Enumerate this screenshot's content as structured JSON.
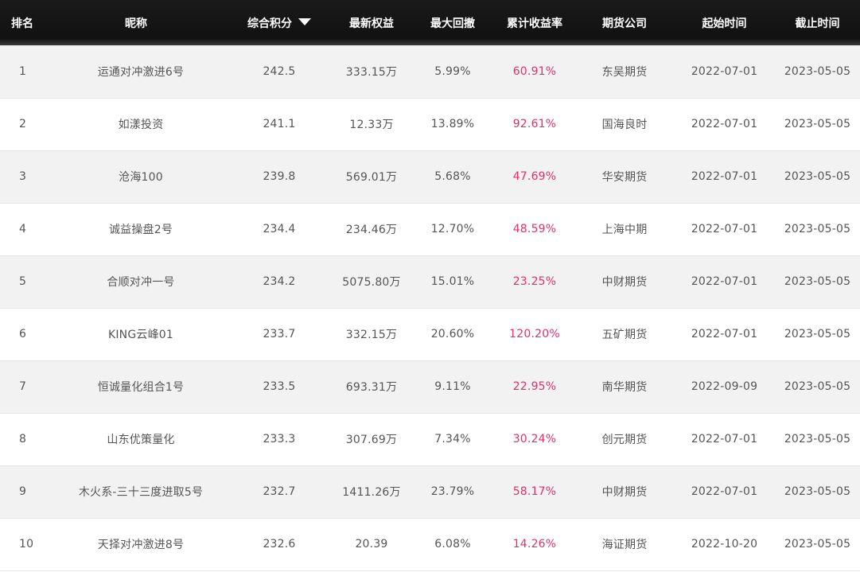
{
  "table": {
    "headers": {
      "rank": "排名",
      "nickname": "昵称",
      "score": "综合积分",
      "latest_equity": "最新权益",
      "max_drawdown": "最大回撤",
      "cumulative_return": "累计收益率",
      "futures_company": "期货公司",
      "start_date": "起始时间",
      "end_date": "截止时间"
    },
    "sort": {
      "column": "score",
      "direction": "descending",
      "icon": "sort-down-icon"
    },
    "colors": {
      "header_bg": "#111111",
      "header_text": "#ffffff",
      "row_odd_bg": "#f2f2f2",
      "row_even_bg": "#ffffff",
      "cell_text": "#555555",
      "return_text": "#e0306b"
    },
    "rows": [
      {
        "rank": "1",
        "nickname": "运通对冲激进6号",
        "score": "242.5",
        "latest_equity": "333.15万",
        "max_drawdown": "5.99%",
        "cumulative_return": "60.91%",
        "futures_company": "东吴期货",
        "start_date": "2022-07-01",
        "end_date": "2023-05-05"
      },
      {
        "rank": "2",
        "nickname": "如漾投资",
        "score": "241.1",
        "latest_equity": "12.33万",
        "max_drawdown": "13.89%",
        "cumulative_return": "92.61%",
        "futures_company": "国海良时",
        "start_date": "2022-07-01",
        "end_date": "2023-05-05"
      },
      {
        "rank": "3",
        "nickname": "沧海100",
        "score": "239.8",
        "latest_equity": "569.01万",
        "max_drawdown": "5.68%",
        "cumulative_return": "47.69%",
        "futures_company": "华安期货",
        "start_date": "2022-07-01",
        "end_date": "2023-05-05"
      },
      {
        "rank": "4",
        "nickname": "诚益操盘2号",
        "score": "234.4",
        "latest_equity": "234.46万",
        "max_drawdown": "12.70%",
        "cumulative_return": "48.59%",
        "futures_company": "上海中期",
        "start_date": "2022-07-01",
        "end_date": "2023-05-05"
      },
      {
        "rank": "5",
        "nickname": "合顺对冲一号",
        "score": "234.2",
        "latest_equity": "5075.80万",
        "max_drawdown": "15.01%",
        "cumulative_return": "23.25%",
        "futures_company": "中财期货",
        "start_date": "2022-07-01",
        "end_date": "2023-05-05"
      },
      {
        "rank": "6",
        "nickname": "KING云峰01",
        "score": "233.7",
        "latest_equity": "332.15万",
        "max_drawdown": "20.60%",
        "cumulative_return": "120.20%",
        "futures_company": "五矿期货",
        "start_date": "2022-07-01",
        "end_date": "2023-05-05"
      },
      {
        "rank": "7",
        "nickname": "恒诚量化组合1号",
        "score": "233.5",
        "latest_equity": "693.31万",
        "max_drawdown": "9.11%",
        "cumulative_return": "22.95%",
        "futures_company": "南华期货",
        "start_date": "2022-09-09",
        "end_date": "2023-05-05"
      },
      {
        "rank": "8",
        "nickname": "山东优策量化",
        "score": "233.3",
        "latest_equity": "307.69万",
        "max_drawdown": "7.34%",
        "cumulative_return": "30.24%",
        "futures_company": "创元期货",
        "start_date": "2022-07-01",
        "end_date": "2023-05-05"
      },
      {
        "rank": "9",
        "nickname": "木火系-三十三度进取5号",
        "score": "232.7",
        "latest_equity": "1411.26万",
        "max_drawdown": "23.79%",
        "cumulative_return": "58.17%",
        "futures_company": "中财期货",
        "start_date": "2022-07-01",
        "end_date": "2023-05-05"
      },
      {
        "rank": "10",
        "nickname": "天择对冲激进8号",
        "score": "232.6",
        "latest_equity": "20.39",
        "max_drawdown": "6.08%",
        "cumulative_return": "14.26%",
        "futures_company": "海证期货",
        "start_date": "2022-10-20",
        "end_date": "2023-05-05"
      }
    ]
  }
}
